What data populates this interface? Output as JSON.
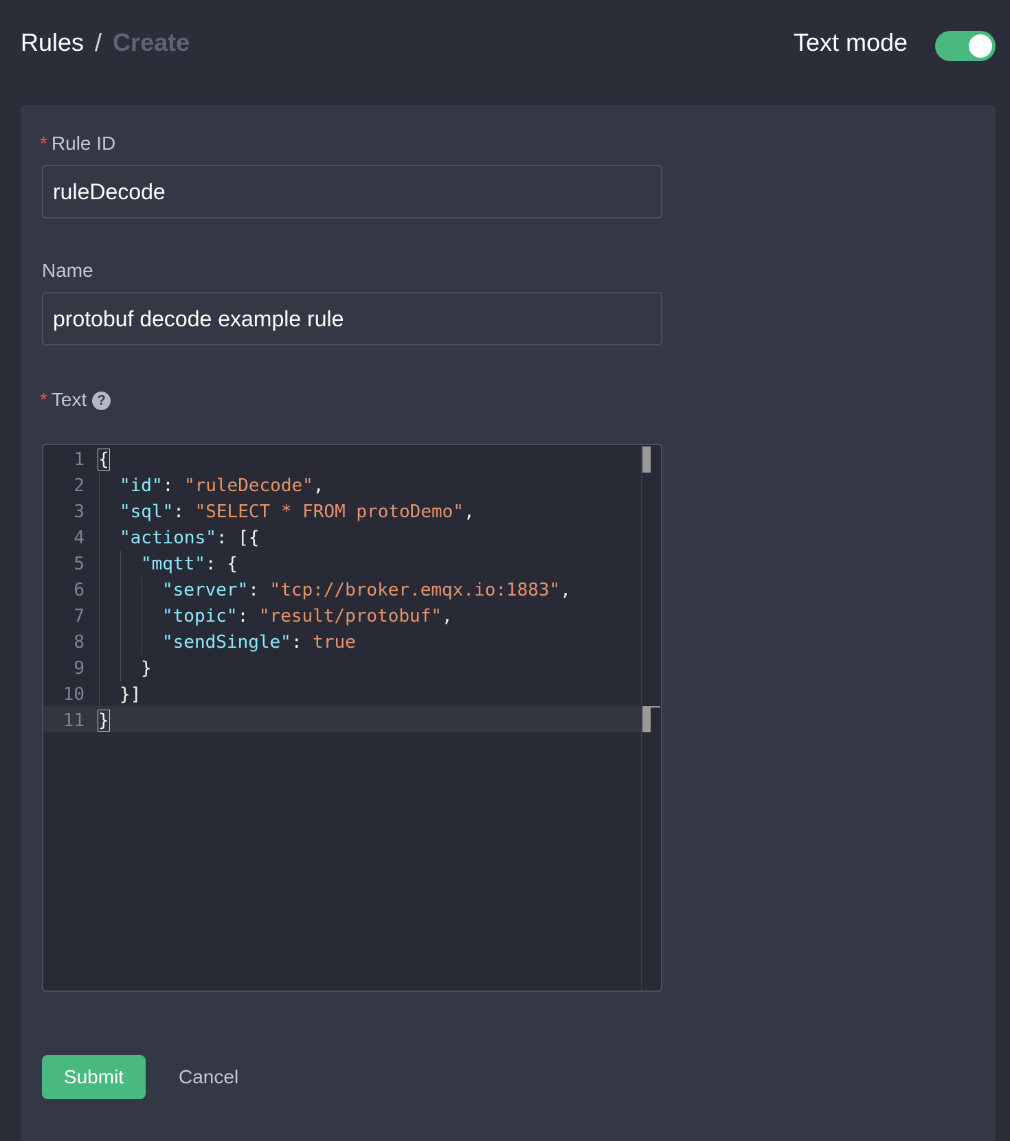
{
  "breadcrumb": {
    "parent": "Rules",
    "separator": "/",
    "current": "Create"
  },
  "header": {
    "mode_label": "Text mode",
    "mode_enabled": true
  },
  "form": {
    "rule_id": {
      "required_mark": "*",
      "label": "Rule ID",
      "value": "ruleDecode"
    },
    "name": {
      "label": "Name",
      "value": "protobuf decode example rule"
    },
    "text": {
      "required_mark": "*",
      "label": "Text",
      "help_glyph": "?",
      "help_icon": "question-circle-icon"
    }
  },
  "editor": {
    "line_numbers": [
      "1",
      "2",
      "3",
      "4",
      "5",
      "6",
      "7",
      "8",
      "9",
      "10",
      "11"
    ],
    "lines": [
      "{",
      "\"id\": \"ruleDecode\",",
      "\"sql\": \"SELECT * FROM protoDemo\",",
      "\"actions\": [{",
      "\"mqtt\": {",
      "\"server\": \"tcp://broker.emqx.io:1883\",",
      "\"topic\": \"result/protobuf\",",
      "\"sendSingle\": true",
      "}",
      "}]",
      "}"
    ],
    "active_line": 11
  },
  "buttons": {
    "submit": "Submit",
    "cancel": "Cancel"
  },
  "colors": {
    "accent": "#4ab97f",
    "required": "#e8546a",
    "key": "#8be9fd",
    "string": "#e8926a",
    "background": "#2b2e38",
    "card": "#343845",
    "editor": "#282a36"
  }
}
